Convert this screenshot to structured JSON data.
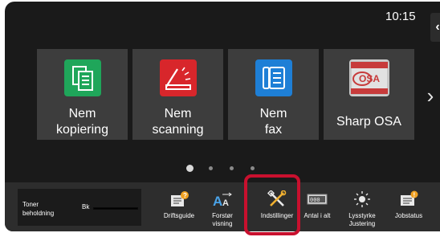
{
  "clock": "10:15",
  "side_tab_icon": "chevron-left-icon",
  "tiles": [
    {
      "label": "Nem\nkopiering",
      "icon": "copy-icon",
      "color": "#1fa65a"
    },
    {
      "label": "Nem\nscanning",
      "icon": "scan-icon",
      "color": "#d8262b"
    },
    {
      "label": "Nem\nfax",
      "icon": "fax-icon",
      "color": "#1e7fd6"
    },
    {
      "label": "Sharp OSA",
      "icon": "sharp-osa-icon",
      "color": "#cfcfcf"
    }
  ],
  "next_page_icon": "chevron-right-icon",
  "pager": {
    "pages": 4,
    "active": 1
  },
  "toner": {
    "label": "Toner\nbeholdning",
    "color_label": "Bk"
  },
  "taskbar": [
    {
      "label": "Driftsguide",
      "icon": "operation-guide-icon"
    },
    {
      "label": "Forstør\nvisning",
      "icon": "enlarge-display-icon"
    },
    {
      "label": "Indstillinger",
      "icon": "settings-tools-icon"
    },
    {
      "label": "Antal i alt",
      "icon": "total-count-icon"
    },
    {
      "label": "Lysstyrke\nJustering",
      "icon": "brightness-icon"
    },
    {
      "label": "Jobstatus",
      "icon": "job-status-icon"
    }
  ]
}
